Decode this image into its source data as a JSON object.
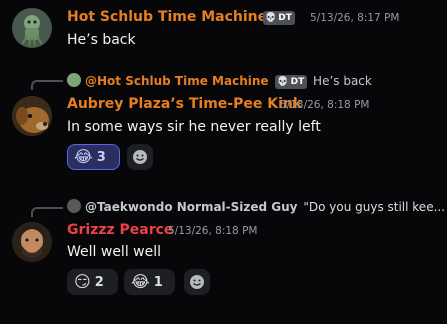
{
  "messages": [
    {
      "author": "Hot Schlub Time Machine",
      "tag": "DT",
      "timestamp": "5/13/26, 8:17 PM",
      "text": "He’s back",
      "author_color": "#e67e22"
    },
    {
      "reply": {
        "author": "@Hot Schlub Time Machine",
        "tag": "DT",
        "text": "He’s back"
      },
      "author": "Aubrey Plaza’s Time-Pee Kink",
      "timestamp": "5/13/26, 8:18 PM",
      "text": "In some ways sir he never really left",
      "author_color": "#e67e22",
      "reactions": [
        {
          "emoji": "😂",
          "count": "3",
          "emoji_name": "joy"
        }
      ]
    },
    {
      "reply": {
        "author": "@Taekwondo Normal-Sized Guy",
        "text": "\"Do you guys still kee..."
      },
      "author": "Grizzz Pearce",
      "timestamp": "5/13/26, 8:18 PM",
      "text": "Well well well",
      "author_color": "#ed4245",
      "reactions": [
        {
          "emoji": "😏",
          "count": "2",
          "emoji_name": "smirk"
        },
        {
          "emoji": "😂",
          "count": "1",
          "emoji_name": "joy"
        }
      ]
    }
  ]
}
